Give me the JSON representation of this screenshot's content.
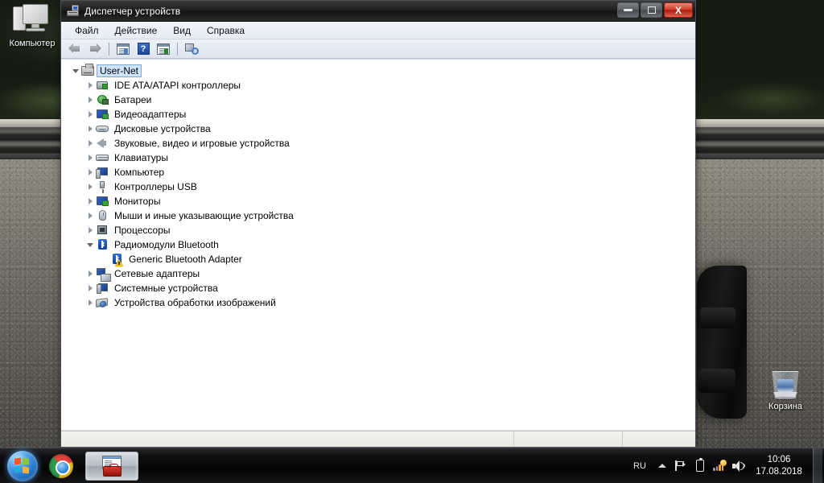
{
  "desktop": {
    "icons": [
      {
        "name": "computer",
        "label": "Компьютер"
      },
      {
        "name": "recycle-bin",
        "label": "Корзина"
      }
    ]
  },
  "window": {
    "title": "Диспетчер устройств",
    "title_icon": "device-manager-icon",
    "controls": {
      "minimize": "–",
      "maximize": "□",
      "close": "X"
    },
    "menu": [
      {
        "name": "file",
        "label": "Файл"
      },
      {
        "name": "action",
        "label": "Действие"
      },
      {
        "name": "view",
        "label": "Вид"
      },
      {
        "name": "help",
        "label": "Справка"
      }
    ],
    "toolbar": [
      {
        "name": "back-button",
        "icon": "back-arrow-icon"
      },
      {
        "name": "forward-button",
        "icon": "forward-arrow-icon"
      },
      {
        "name": "show-hide-console-tree-button",
        "icon": "console-tree-icon"
      },
      {
        "name": "help-button",
        "icon": "help-question-icon"
      },
      {
        "name": "properties-button",
        "icon": "properties-panel-icon"
      },
      {
        "name": "scan-hardware-changes-button",
        "icon": "scan-hardware-icon"
      }
    ],
    "statusbar": {
      "pane1": "",
      "pane2": "",
      "pane3": ""
    }
  },
  "tree": {
    "root": {
      "label": "User-Net",
      "icon": "computer-node-icon",
      "expanded": true,
      "selected": true
    },
    "nodes": [
      {
        "label": "IDE ATA/ATAPI контроллеры",
        "icon": "ide-controller-icon",
        "expanded": false,
        "level": 1
      },
      {
        "label": "Батареи",
        "icon": "battery-icon",
        "expanded": false,
        "level": 1
      },
      {
        "label": "Видеоадаптеры",
        "icon": "display-adapter-icon",
        "expanded": false,
        "level": 1
      },
      {
        "label": "Дисковые устройства",
        "icon": "disk-drive-icon",
        "expanded": false,
        "level": 1
      },
      {
        "label": "Звуковые, видео и игровые устройства",
        "icon": "sound-device-icon",
        "expanded": false,
        "level": 1
      },
      {
        "label": "Клавиатуры",
        "icon": "keyboard-icon",
        "expanded": false,
        "level": 1
      },
      {
        "label": "Компьютер",
        "icon": "computer-icon",
        "expanded": false,
        "level": 1
      },
      {
        "label": "Контроллеры USB",
        "icon": "usb-controller-icon",
        "expanded": false,
        "level": 1
      },
      {
        "label": "Мониторы",
        "icon": "monitor-icon",
        "expanded": false,
        "level": 1
      },
      {
        "label": "Мыши и иные указывающие устройства",
        "icon": "mouse-icon",
        "expanded": false,
        "level": 1
      },
      {
        "label": "Процессоры",
        "icon": "processor-icon",
        "expanded": false,
        "level": 1
      },
      {
        "label": "Радиомодули Bluetooth",
        "icon": "bluetooth-icon",
        "expanded": true,
        "level": 1
      },
      {
        "label": "Generic Bluetooth Adapter",
        "icon": "bluetooth-device-warning-icon",
        "expanded": null,
        "level": 2,
        "warning": true
      },
      {
        "label": "Сетевые адаптеры",
        "icon": "network-adapter-icon",
        "expanded": false,
        "level": 1
      },
      {
        "label": "Системные устройства",
        "icon": "system-device-icon",
        "expanded": false,
        "level": 1
      },
      {
        "label": "Устройства обработки изображений",
        "icon": "imaging-device-icon",
        "expanded": false,
        "level": 1
      }
    ]
  },
  "taskbar": {
    "start": {
      "name": "start-orb",
      "label": ""
    },
    "quick_launch": [
      {
        "name": "chrome-launcher",
        "icon": "chrome-icon"
      }
    ],
    "tasks": [
      {
        "name": "taskbar-device-manager",
        "icon": "device-manager-icon",
        "active": true
      }
    ],
    "tray": {
      "language": "RU",
      "items": [
        {
          "name": "show-hidden-icons-button",
          "icon": "chevron-up-icon"
        },
        {
          "name": "action-center-flag",
          "icon": "flag-icon"
        },
        {
          "name": "battery-status",
          "icon": "battery-icon"
        },
        {
          "name": "network-status",
          "icon": "network-warning-icon"
        },
        {
          "name": "volume-control",
          "icon": "speaker-icon"
        }
      ],
      "clock_time": "10:06",
      "clock_date": "17.08.2018"
    }
  },
  "colors": {
    "accent_blue": "#2f6fd6",
    "close_red": "#d33c2b",
    "selection_blue": "#cfe3fb",
    "warning_yellow": "#f2c40e"
  }
}
